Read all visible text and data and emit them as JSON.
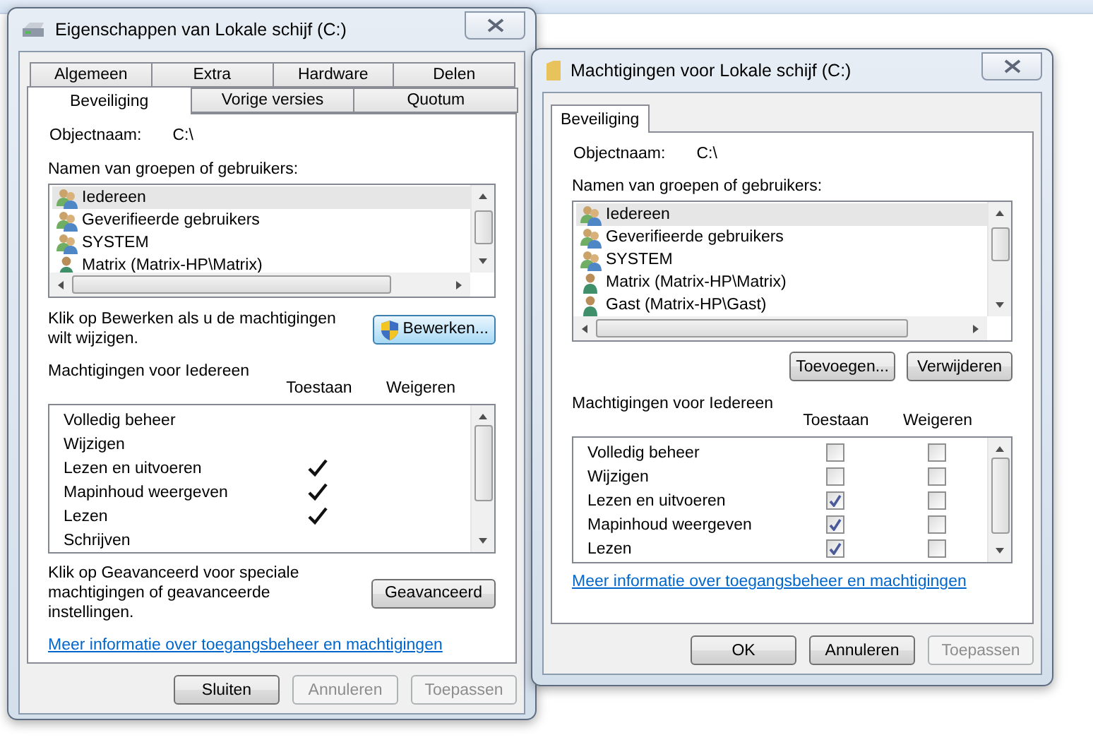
{
  "properties_dialog": {
    "title": "Eigenschappen van Lokale schijf (C:)",
    "tab_rows": [
      [
        {
          "label": "Algemeen",
          "selected": false
        },
        {
          "label": "Extra",
          "selected": false
        },
        {
          "label": "Hardware",
          "selected": false
        },
        {
          "label": "Delen",
          "selected": false
        }
      ],
      [
        {
          "label": "Beveiliging",
          "selected": true
        },
        {
          "label": "Vorige versies",
          "selected": false
        },
        {
          "label": "Quotum",
          "selected": false
        }
      ]
    ],
    "object_label": "Objectnaam:",
    "object_value": "C:\\",
    "groups_label": "Namen van groepen of gebruikers:",
    "groups": [
      {
        "name": "Iedereen",
        "kind": "group",
        "selected": true
      },
      {
        "name": "Geverifieerde gebruikers",
        "kind": "group",
        "selected": false
      },
      {
        "name": "SYSTEM",
        "kind": "group",
        "selected": false
      },
      {
        "name": "Matrix (Matrix-HP\\Matrix)",
        "kind": "user",
        "selected": false
      }
    ],
    "edit_hint": "Klik op Bewerken als u de machtigingen wilt wijzigen.",
    "edit_button": "Bewerken...",
    "permissions_label": "Machtigingen voor Iedereen",
    "columns": [
      "Toestaan",
      "Weigeren"
    ],
    "permissions": [
      {
        "name": "Volledig beheer",
        "allow": false,
        "deny": false
      },
      {
        "name": "Wijzigen",
        "allow": false,
        "deny": false
      },
      {
        "name": "Lezen en uitvoeren",
        "allow": true,
        "deny": false
      },
      {
        "name": "Mapinhoud weergeven",
        "allow": true,
        "deny": false
      },
      {
        "name": "Lezen",
        "allow": true,
        "deny": false
      },
      {
        "name": "Schrijven",
        "allow": false,
        "deny": false
      }
    ],
    "advanced_hint": "Klik op Geavanceerd voor speciale machtigingen of geavanceerde instellingen.",
    "advanced_button": "Geavanceerd",
    "link": "Meer informatie over toegangsbeheer en machtigingen",
    "buttons": [
      {
        "label": "Sluiten",
        "disabled": false
      },
      {
        "label": "Annuleren",
        "disabled": true
      },
      {
        "label": "Toepassen",
        "disabled": true
      }
    ]
  },
  "permissions_dialog": {
    "title": "Machtigingen voor Lokale schijf (C:)",
    "tabs": [
      {
        "label": "Beveiliging",
        "selected": true
      }
    ],
    "object_label": "Objectnaam:",
    "object_value": "C:\\",
    "groups_label": "Namen van groepen of gebruikers:",
    "groups": [
      {
        "name": "Iedereen",
        "kind": "group",
        "selected": true
      },
      {
        "name": "Geverifieerde gebruikers",
        "kind": "group",
        "selected": false
      },
      {
        "name": "SYSTEM",
        "kind": "group",
        "selected": false
      },
      {
        "name": "Matrix (Matrix-HP\\Matrix)",
        "kind": "user",
        "selected": false
      },
      {
        "name": "Gast (Matrix-HP\\Gast)",
        "kind": "user",
        "selected": false
      }
    ],
    "group_buttons": [
      "Toevoegen...",
      "Verwijderen"
    ],
    "permissions_label": "Machtigingen voor Iedereen",
    "columns": [
      "Toestaan",
      "Weigeren"
    ],
    "permissions": [
      {
        "name": "Volledig beheer",
        "allow": false,
        "deny": false
      },
      {
        "name": "Wijzigen",
        "allow": false,
        "deny": false
      },
      {
        "name": "Lezen en uitvoeren",
        "allow": true,
        "deny": false
      },
      {
        "name": "Mapinhoud weergeven",
        "allow": true,
        "deny": false
      },
      {
        "name": "Lezen",
        "allow": true,
        "deny": false
      }
    ],
    "link": "Meer informatie over toegangsbeheer en machtigingen",
    "buttons": [
      {
        "label": "OK",
        "disabled": false
      },
      {
        "label": "Annuleren",
        "disabled": false
      },
      {
        "label": "Toepassen",
        "disabled": true
      }
    ]
  }
}
